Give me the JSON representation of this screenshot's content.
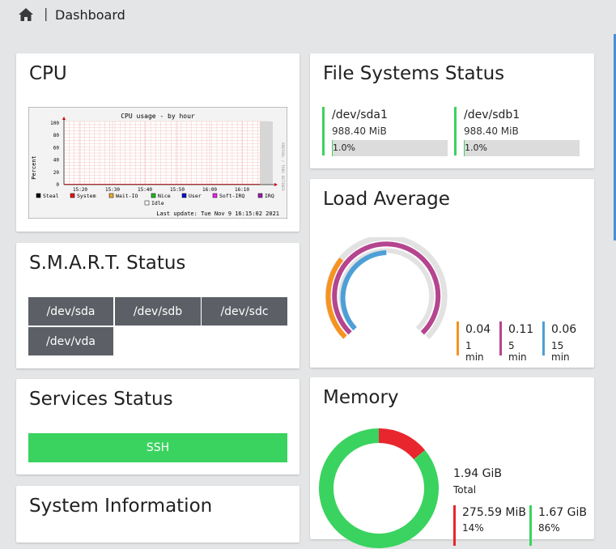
{
  "breadcrumb": {
    "separator": "|",
    "current": "Dashboard"
  },
  "cpu": {
    "title": "CPU",
    "graph": {
      "title": "CPU usage - by hour",
      "ylabel": "Percent",
      "side_label": "RRDTOOL / TOBI OETIKER",
      "y_ticks": [
        "100",
        "80",
        "60",
        "40",
        "20",
        "0"
      ],
      "x_ticks": [
        "15:20",
        "15:30",
        "15:40",
        "15:50",
        "16:00",
        "16:10"
      ],
      "legend": [
        "Steal",
        "System",
        "Wait-IO",
        "Nice",
        "User",
        "Soft-IRQ",
        "IRQ",
        "Idle"
      ],
      "legend_colors": [
        "#000000",
        "#ee1111",
        "#eeaa33",
        "#22bb22",
        "#1111cc",
        "#ee22ee",
        "#9922aa",
        "#ffffff"
      ],
      "last_update": "Last update: Tue Nov  9 16:15:02 2021"
    }
  },
  "smart": {
    "title": "S.M.A.R.T. Status",
    "disks": [
      "/dev/sda",
      "/dev/sdb",
      "/dev/sdc",
      "/dev/vda"
    ]
  },
  "services": {
    "title": "Services Status",
    "items": [
      "SSH"
    ]
  },
  "sysinfo": {
    "title": "System Information"
  },
  "filesystems": {
    "title": "File Systems Status",
    "items": [
      {
        "name": "/dev/sda1",
        "size": "988.40 MiB",
        "percent": "1.0%",
        "fill": 0.01
      },
      {
        "name": "/dev/sdb1",
        "size": "988.40 MiB",
        "percent": "1.0%",
        "fill": 0.01
      }
    ]
  },
  "load": {
    "title": "Load Average",
    "items": [
      {
        "value": "0.04",
        "label": "1 min",
        "color": "#f7931e"
      },
      {
        "value": "0.11",
        "label": "5 min",
        "color": "#b5458f"
      },
      {
        "value": "0.06",
        "label": "15 min",
        "color": "#4d9fd6"
      }
    ]
  },
  "memory": {
    "title": "Memory",
    "total": "1.94 GiB",
    "total_label": "Total",
    "items": [
      {
        "value": "275.59 MiB",
        "percent": "14%",
        "color": "#e8262e",
        "fraction": 0.14
      },
      {
        "value": "1.67 GiB",
        "percent": "86%",
        "color": "#3ad35f",
        "fraction": 0.86
      }
    ]
  }
}
